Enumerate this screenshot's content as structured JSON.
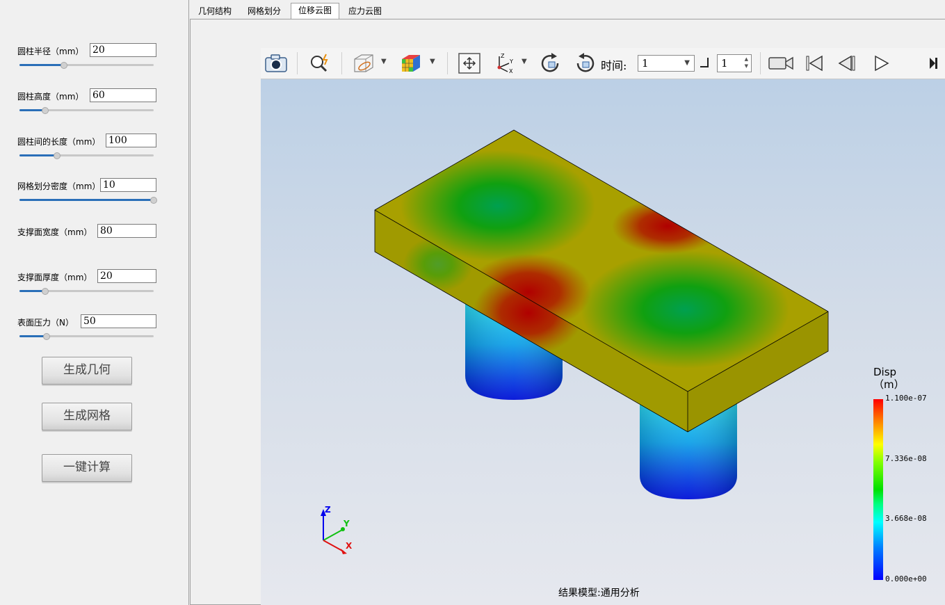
{
  "tabs": [
    {
      "label": "几何结构",
      "active": false
    },
    {
      "label": "网格划分",
      "active": false
    },
    {
      "label": "位移云图",
      "active": true
    },
    {
      "label": "应力云图",
      "active": false
    }
  ],
  "params": [
    {
      "label": "圆柱半径（mm）",
      "value": "20",
      "slider": 0.33
    },
    {
      "label": "圆柱高度（mm）",
      "value": "60",
      "slider": 0.19
    },
    {
      "label": "圆柱间的长度（mm）",
      "value": "100",
      "slider": 0.28
    },
    {
      "label": "网格划分密度（mm）",
      "value": "10",
      "slider": 1.0
    },
    {
      "label": "支撑面宽度（mm）",
      "value": "80",
      "slider": null
    },
    {
      "label": "支撑面厚度（mm）",
      "value": "20",
      "slider": 0.19
    },
    {
      "label": "表面压力（N）",
      "value": "50",
      "slider": 0.2
    }
  ],
  "buttons": {
    "generate_geometry": "生成几何",
    "generate_mesh": "生成网格",
    "one_click_compute": "一键计算"
  },
  "toolbar": {
    "time_label": "时间:",
    "time_value": "1",
    "step_value": "1"
  },
  "legend": {
    "title_line1": "Disp",
    "title_line2": "（m）",
    "max": "1.100e-07",
    "mid_high": "7.336e-08",
    "mid_low": "3.668e-08",
    "min": "0.000e+00"
  },
  "axes": {
    "x": "X",
    "y": "Y",
    "z": "Z"
  },
  "status": "结果模型:通用分析",
  "colors": {
    "slider_fill": "#2a6fb8",
    "accent": "#2a6fb8"
  }
}
